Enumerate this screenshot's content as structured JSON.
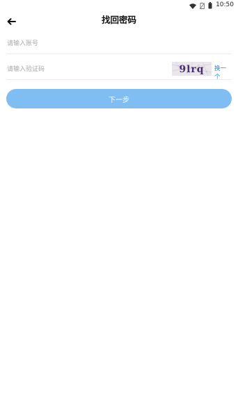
{
  "status_bar": {
    "time": "10:50",
    "icons": [
      "wifi-icon",
      "sim-off-icon",
      "battery-icon"
    ]
  },
  "header": {
    "title": "找回密码",
    "back_icon": "arrow-left-icon"
  },
  "form": {
    "account": {
      "placeholder": "请输入账号",
      "value": ""
    },
    "captcha": {
      "placeholder": "请输入验证码",
      "value": "",
      "image_text": "9lrq",
      "refresh_label": "换一个"
    }
  },
  "next_button": {
    "label": "下一步"
  },
  "colors": {
    "accent": "#7fbdf3",
    "link": "#2f7fd6",
    "placeholder": "#a9a9a9",
    "divider": "#ececec"
  }
}
